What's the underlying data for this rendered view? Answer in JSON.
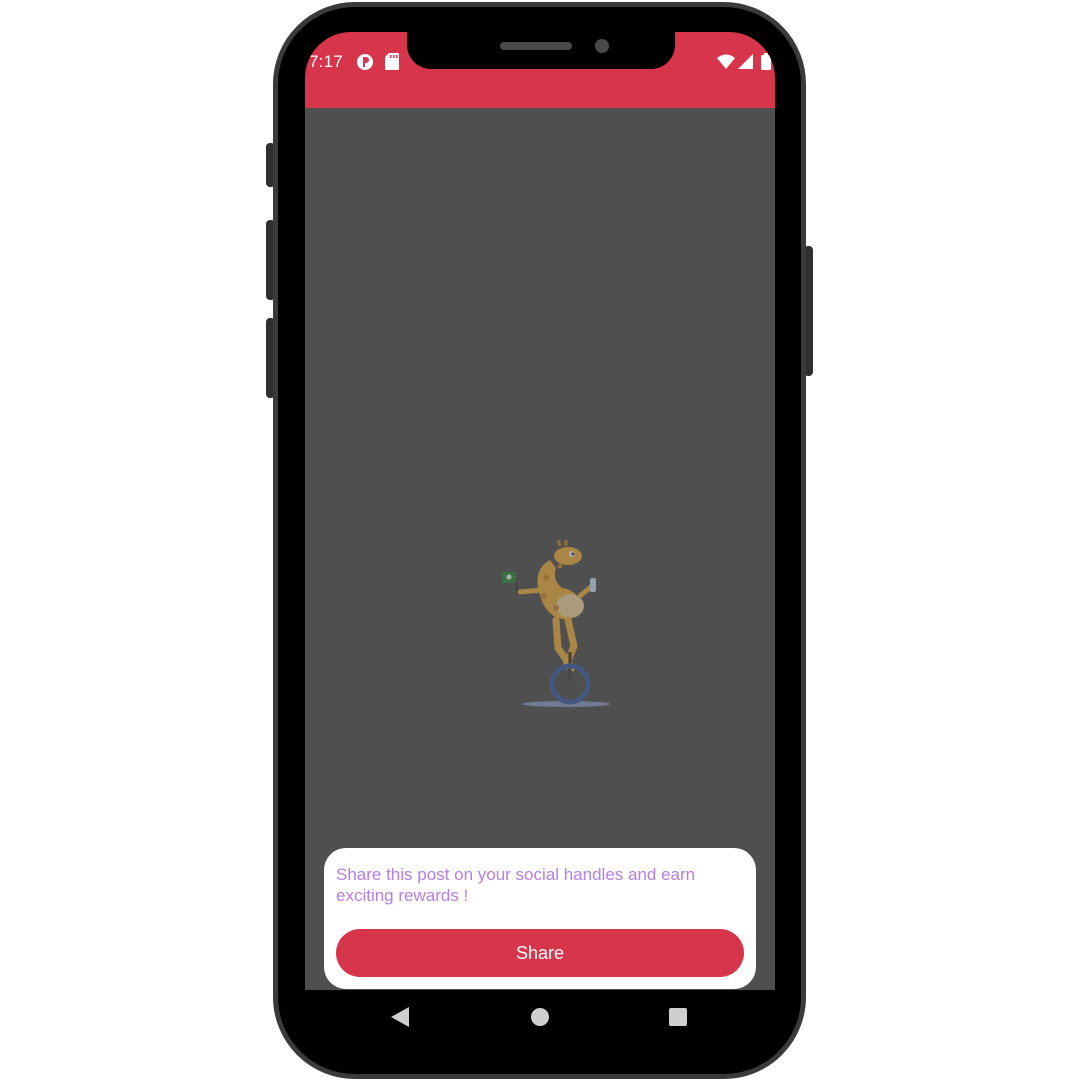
{
  "status_bar": {
    "time": "7:17",
    "icons": [
      "app-notification-icon",
      "sd-card-icon",
      "wifi-icon",
      "cellular-signal-icon",
      "battery-icon"
    ]
  },
  "colors": {
    "accent": "#d6354b",
    "message_text": "#b77ee6",
    "backdrop": "#4f4f4f"
  },
  "dialog": {
    "message": "Share this post on your social handles and earn exciting rewards !",
    "share_label": "Share"
  },
  "navigation": {
    "icons": [
      "back-icon",
      "home-icon",
      "recents-icon"
    ]
  }
}
